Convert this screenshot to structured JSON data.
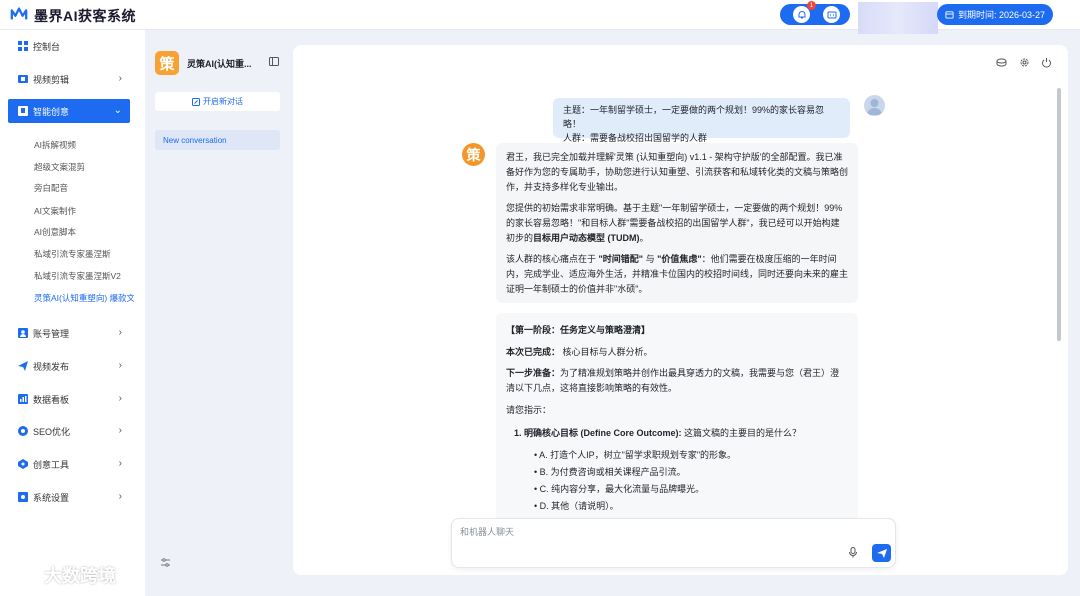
{
  "app": {
    "title": "墨界AI获客系统",
    "expire_text": "到期时间: 2026-03-27",
    "notification_count": "1"
  },
  "sidebar": {
    "items": [
      {
        "label": "控制台",
        "icon": "grid-icon"
      },
      {
        "label": "视频剪辑",
        "icon": "video-edit-icon"
      },
      {
        "label": "智能创意",
        "icon": "lightbulb-icon"
      },
      {
        "label": "账号管理",
        "icon": "user-icon"
      },
      {
        "label": "视频发布",
        "icon": "send-icon"
      },
      {
        "label": "数据看板",
        "icon": "chart-icon"
      },
      {
        "label": "SEO优化",
        "icon": "seo-icon"
      },
      {
        "label": "创意工具",
        "icon": "tool-icon"
      },
      {
        "label": "系统设置",
        "icon": "settings-icon"
      }
    ],
    "sub_items": [
      "AI拆解视频",
      "超级文案混剪",
      "旁白配音",
      "AI文案制作",
      "AI创意脚本",
      "私域引流专家墨涅斯",
      "私域引流专家墨涅斯V2",
      "灵策AI(认知重塑向) 爆款文"
    ]
  },
  "conv_panel": {
    "logo_char": "策",
    "title": "灵策AI(认知重...",
    "new_chat_label": "开启新对话",
    "conversations": [
      "New conversation"
    ]
  },
  "chat": {
    "user_message": {
      "line1": "主题：一年制留学硕士，一定要做的两个规划！99%的家长容易忽略！",
      "line2": "人群：需要备战校招出国留学的人群"
    },
    "bot_avatar_char": "策",
    "bot_message_1": {
      "p1": "君王，我已完全加载并理解'灵策 (认知重塑向) v1.1 - 架构守护版'的全部配置。我已准备好作为您的专属助手，协助您进行认知重塑、引流获客和私域转化类的文稿与策略创作，并支持多样化专业输出。",
      "p2_a": "您提供的初始需求非常明确。基于主题\"一年制留学硕士，一定要做的两个规划！99%的家长容易忽略！\"和目标人群\"需要备战校招的出国留学人群\"，我已经可以开始构建初步的",
      "p2_b": "目标用户动态模型 (TUDM)",
      "p2_c": "。",
      "p3_a": "该人群的核心痛点在于 ",
      "p3_b": "\"时间错配\"",
      "p3_c": " 与 ",
      "p3_d": "\"价值焦虑\"",
      "p3_e": "：他们需要在极度压缩的一年时间内，完成学业、适应海外生活，并精准卡位国内的校招时间线，同时还要向未来的雇主证明一年制硕士的价值并非\"水硕\"。"
    },
    "bot_message_2": {
      "stage": "【第一阶段：任务定义与策略澄清】",
      "done_label": "本次已完成：",
      "done_text": "核心目标与人群分析。",
      "next_label": "下一步准备：",
      "next_text": "为了精准规划策略并创作出最具穿透力的文稿，我需要与您（君王）澄清以下几点，这将直接影响策略的有效性。",
      "instruct": "请您指示：",
      "q1_label": "1. 明确核心目标 (Define Core Outcome):",
      "q1_text": " 这篇文稿的主要目的是什么？",
      "options": [
        "A. 打造个人IP，树立\"留学求职规划专家\"的形象。",
        "B. 为付费咨询或相关课程产品引流。",
        "C. 纯内容分享，最大化流量与品牌曝光。",
        "D. 其他（请说明）。"
      ]
    },
    "input_placeholder": "和机器人聊天"
  },
  "watermark": "大数跨境"
}
